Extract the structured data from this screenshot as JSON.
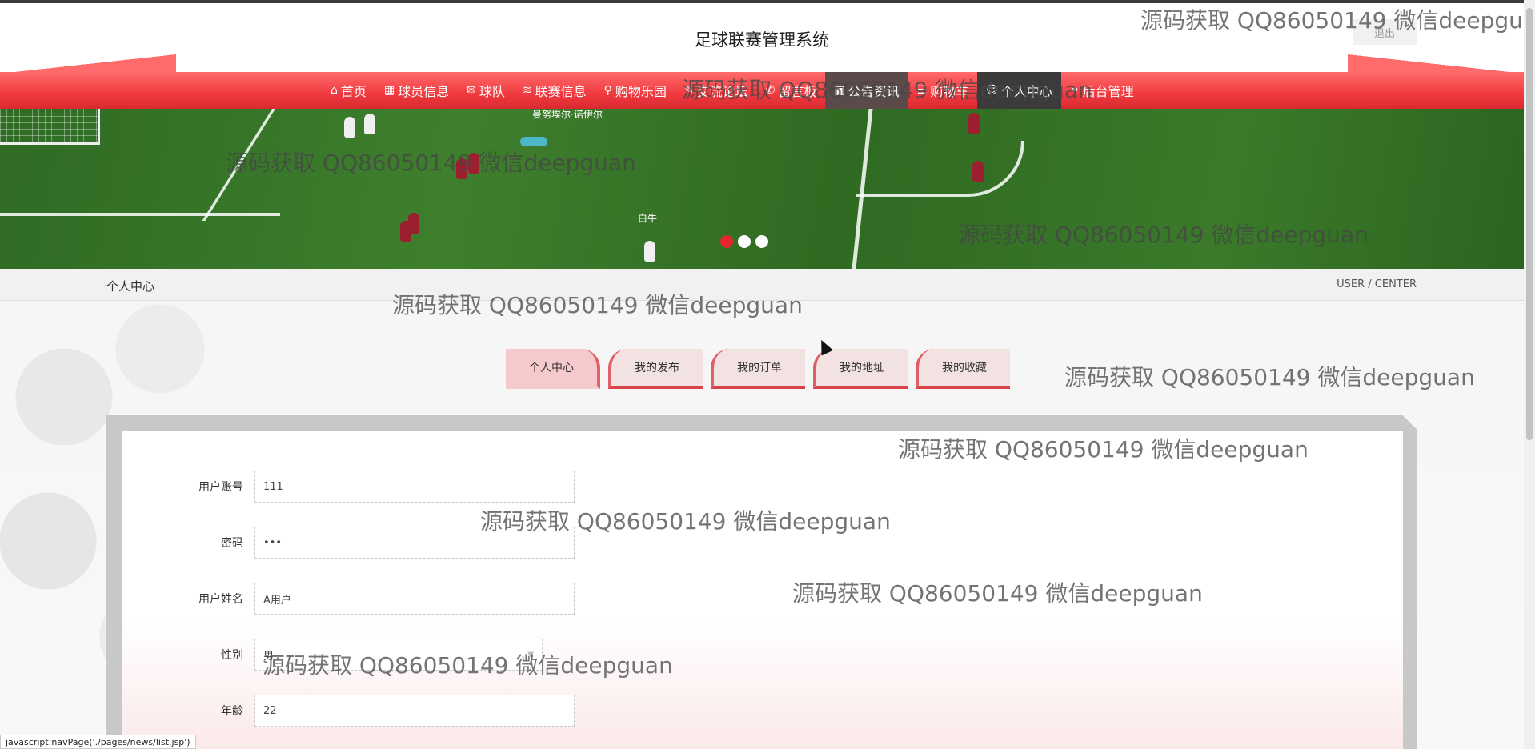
{
  "header": {
    "title": "足球联赛管理系统",
    "logout_label": "退出"
  },
  "nav": {
    "items": [
      {
        "label": "首页",
        "icon": "⌂"
      },
      {
        "label": "球员信息",
        "icon": "▦"
      },
      {
        "label": "球队",
        "icon": "✉"
      },
      {
        "label": "联赛信息",
        "icon": "≋"
      },
      {
        "label": "购物乐园",
        "icon": "⚲"
      },
      {
        "label": "交流论坛",
        "icon": "✎"
      },
      {
        "label": "留言板",
        "icon": "✆"
      },
      {
        "label": "公告资讯",
        "icon": "▣"
      },
      {
        "label": "购物车",
        "icon": "☰"
      },
      {
        "label": "个人中心",
        "icon": "☺"
      },
      {
        "label": "后台管理",
        "icon": "⚭"
      }
    ],
    "active_index": 9
  },
  "banner": {
    "caption_top": "曼努埃尔·诺伊尔",
    "caption_mid": "白牛",
    "slide_count": 3,
    "active_slide": 0
  },
  "breadcrumb": {
    "title": "个人中心",
    "subtitle": "USER / CENTER"
  },
  "tabs": [
    {
      "label": "个人中心",
      "active": true
    },
    {
      "label": "我的发布",
      "active": false
    },
    {
      "label": "我的订单",
      "active": false
    },
    {
      "label": "我的地址",
      "active": false
    },
    {
      "label": "我的收藏",
      "active": false
    }
  ],
  "form": {
    "account_label": "用户账号",
    "account_value": "111",
    "password_label": "密码",
    "password_value": "•••",
    "name_label": "用户姓名",
    "name_value": "A用户",
    "gender_label": "性别",
    "gender_value": "男",
    "age_label": "年龄",
    "age_value": "22"
  },
  "status_bar": {
    "text": "javascript:navPage('./pages/news/list.jsp')"
  },
  "watermark_text": "源码获取 QQ86050149 微信deepguan",
  "watermark_text_cut": "源码获取 QQ86050149 微信deepgu",
  "colors": {
    "nav_red": "#f03a40",
    "nav_active": "#3b3b3b",
    "tab_pink": "#f6c9cc",
    "dot_active": "#e8242d"
  }
}
